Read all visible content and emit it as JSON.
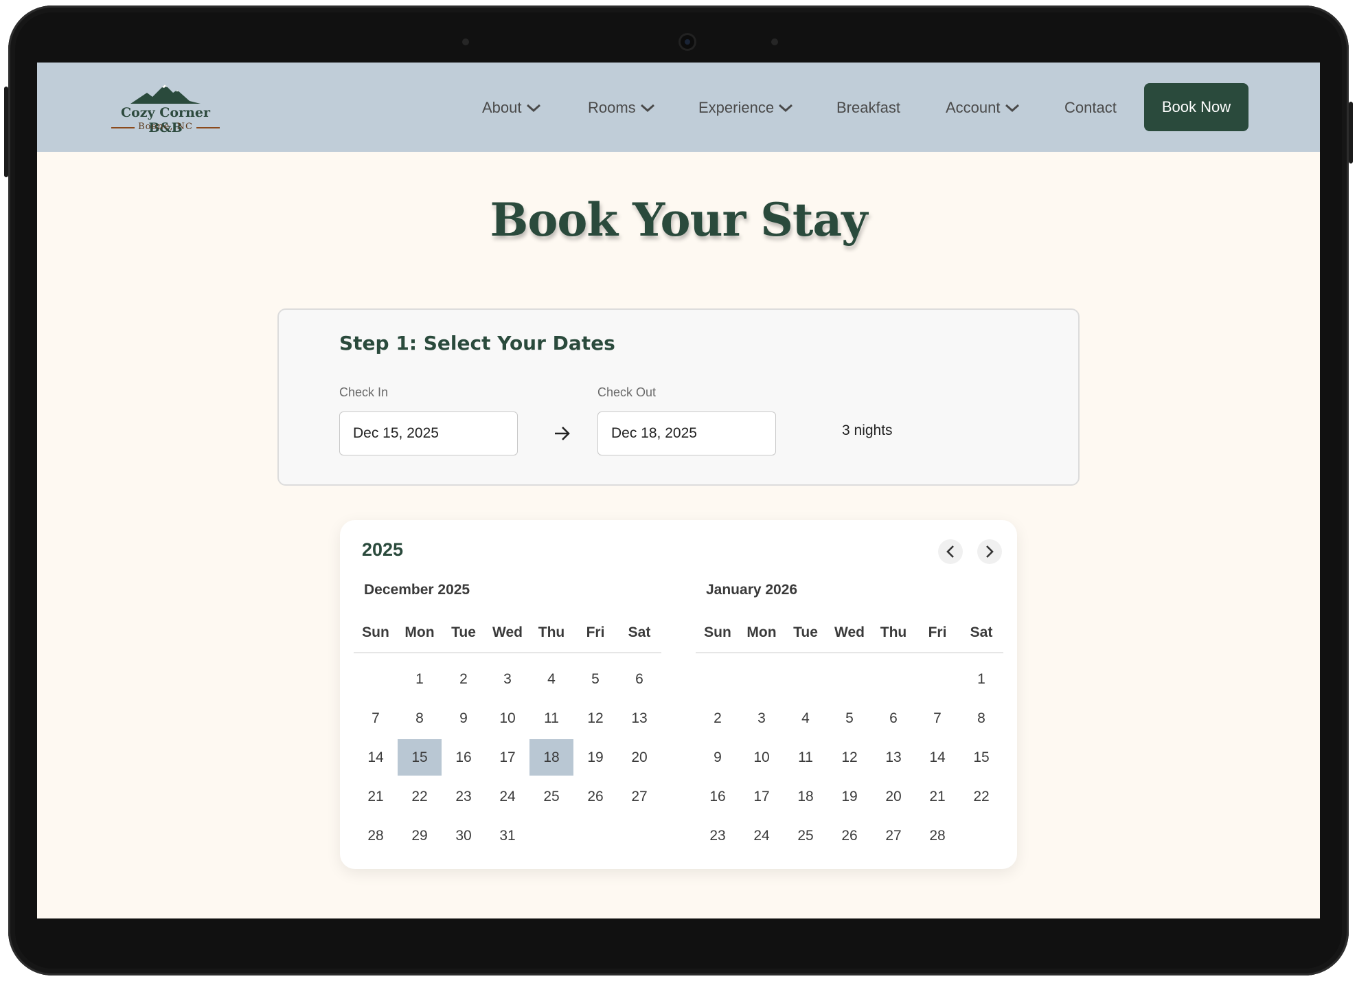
{
  "nav": {
    "brand_name": "Cozy Corner B&B",
    "brand_location": "Boone, NC",
    "items": [
      {
        "label": "About",
        "dropdown": true
      },
      {
        "label": "Rooms",
        "dropdown": true
      },
      {
        "label": "Experience",
        "dropdown": true
      },
      {
        "label": "Breakfast",
        "dropdown": false
      },
      {
        "label": "Account",
        "dropdown": true
      },
      {
        "label": "Contact",
        "dropdown": false
      }
    ],
    "cta_label": "Book Now"
  },
  "page": {
    "title": "Book Your Stay"
  },
  "step": {
    "title": "Step 1: Select Your Dates",
    "check_in_label": "Check In",
    "check_in_value": "Dec 15, 2025",
    "check_out_label": "Check Out",
    "check_out_value": "Dec 18, 2025",
    "nights": "3 nights"
  },
  "calendar": {
    "year": "2025",
    "weekdays": [
      "Sun",
      "Mon",
      "Tue",
      "Wed",
      "Thu",
      "Fri",
      "Sat"
    ],
    "months": [
      {
        "name": "December 2025",
        "first_weekday": 1,
        "days": 31,
        "selected": [
          15,
          18
        ]
      },
      {
        "name": "January 2026",
        "first_weekday": 6,
        "days": 28,
        "selected": []
      }
    ]
  },
  "colors": {
    "nav_bg": "#c0cdd8",
    "brand_green": "#2a4a3c",
    "page_bg": "#fef9f2",
    "selected_day": "#b9c7d3"
  }
}
